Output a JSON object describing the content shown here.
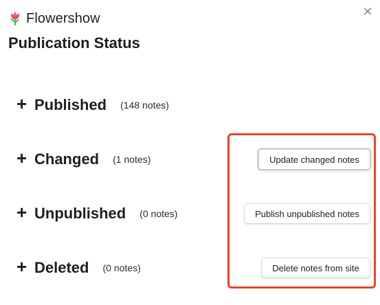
{
  "app": {
    "name": "Flowershow",
    "logo_icon": "tulip-icon",
    "close_glyph": "✕"
  },
  "page_title": "Publication Status",
  "colors": {
    "highlight_border": "#e8442b",
    "tulip_red": "#e8455a",
    "tulip_leaf": "#4caf50"
  },
  "statuses": [
    {
      "key": "published",
      "label": "Published",
      "count_text": "(148 notes)"
    },
    {
      "key": "changed",
      "label": "Changed",
      "count_text": "(1 notes)",
      "action_label": "Update changed notes"
    },
    {
      "key": "unpublished",
      "label": "Unpublished",
      "count_text": "(0 notes)",
      "action_label": "Publish unpublished notes"
    },
    {
      "key": "deleted",
      "label": "Deleted",
      "count_text": "(0 notes)",
      "action_label": "Delete notes from site"
    }
  ],
  "expand_glyph": "+"
}
